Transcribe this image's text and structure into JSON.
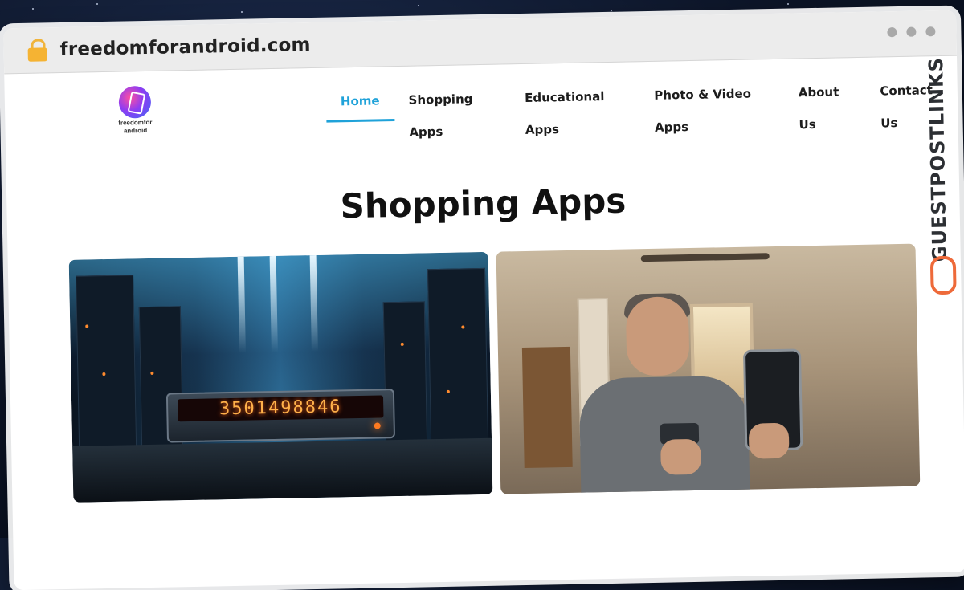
{
  "browser": {
    "url": "freedomforandroid.com",
    "lock_icon": "lock-icon",
    "window_dots": 3
  },
  "site": {
    "logo": {
      "line1": "freedomfor",
      "line2": "android"
    },
    "nav": [
      {
        "label": "Home",
        "active": true
      },
      {
        "label": "Shopping Apps",
        "active": false
      },
      {
        "label": "Educational Apps",
        "active": false
      },
      {
        "label": "Photo & Video Apps",
        "active": false
      },
      {
        "label": "About Us",
        "active": false
      },
      {
        "label": "Contact Us",
        "active": false
      }
    ],
    "accent_color": "#1fa2d9",
    "page_title": "Shopping Apps",
    "cards": [
      {
        "image": "datacenter-counter-image",
        "counter_text": "3501498846"
      },
      {
        "image": "man-with-phones-image"
      }
    ]
  },
  "watermark": {
    "text": "GUESTPOSTLINKS",
    "icon": "chain-link-icon",
    "color": "#ee6a3a"
  }
}
